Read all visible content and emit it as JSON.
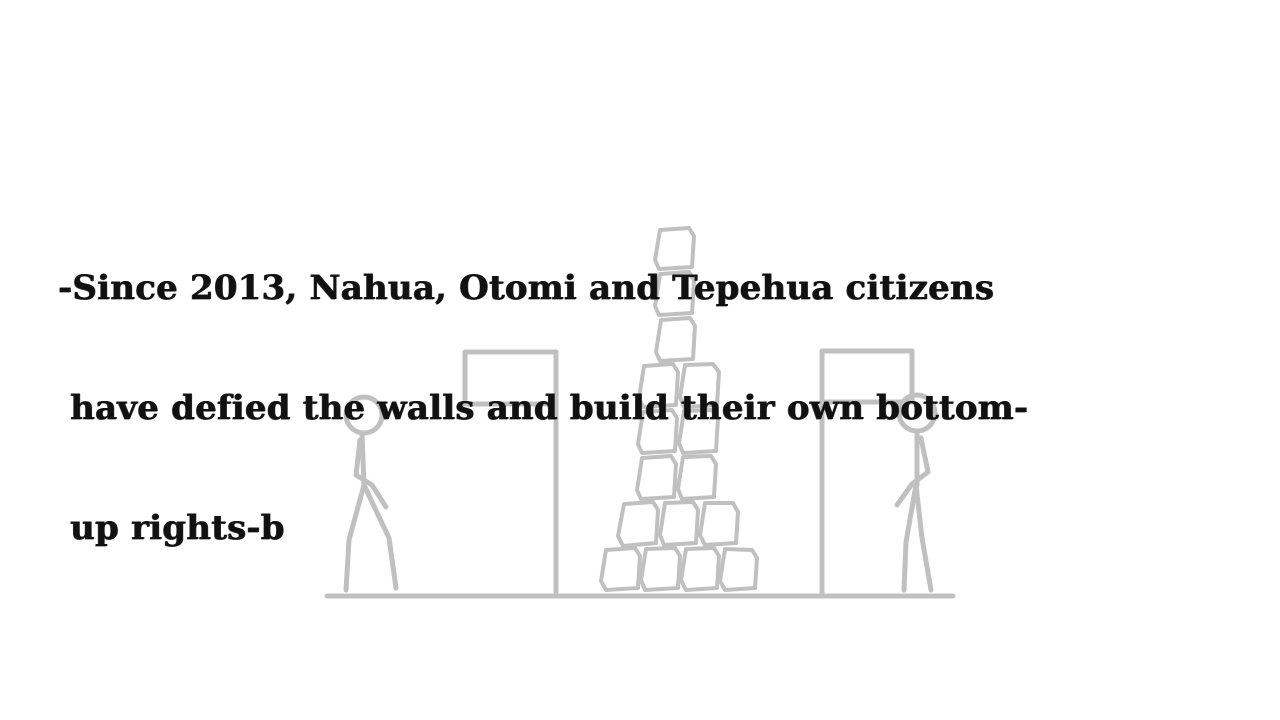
{
  "caption": {
    "lines": [
      "-Since 2013, Nahua, Otomi and Tepehua citizens",
      " have defied the walls and build their own bottom-",
      " up rights-b"
    ]
  },
  "illustration": {
    "stroke_color": "#c0c0c0",
    "elements": [
      "ground-line",
      "left-person",
      "left-flag",
      "stone-tower",
      "right-flag",
      "right-person"
    ]
  }
}
